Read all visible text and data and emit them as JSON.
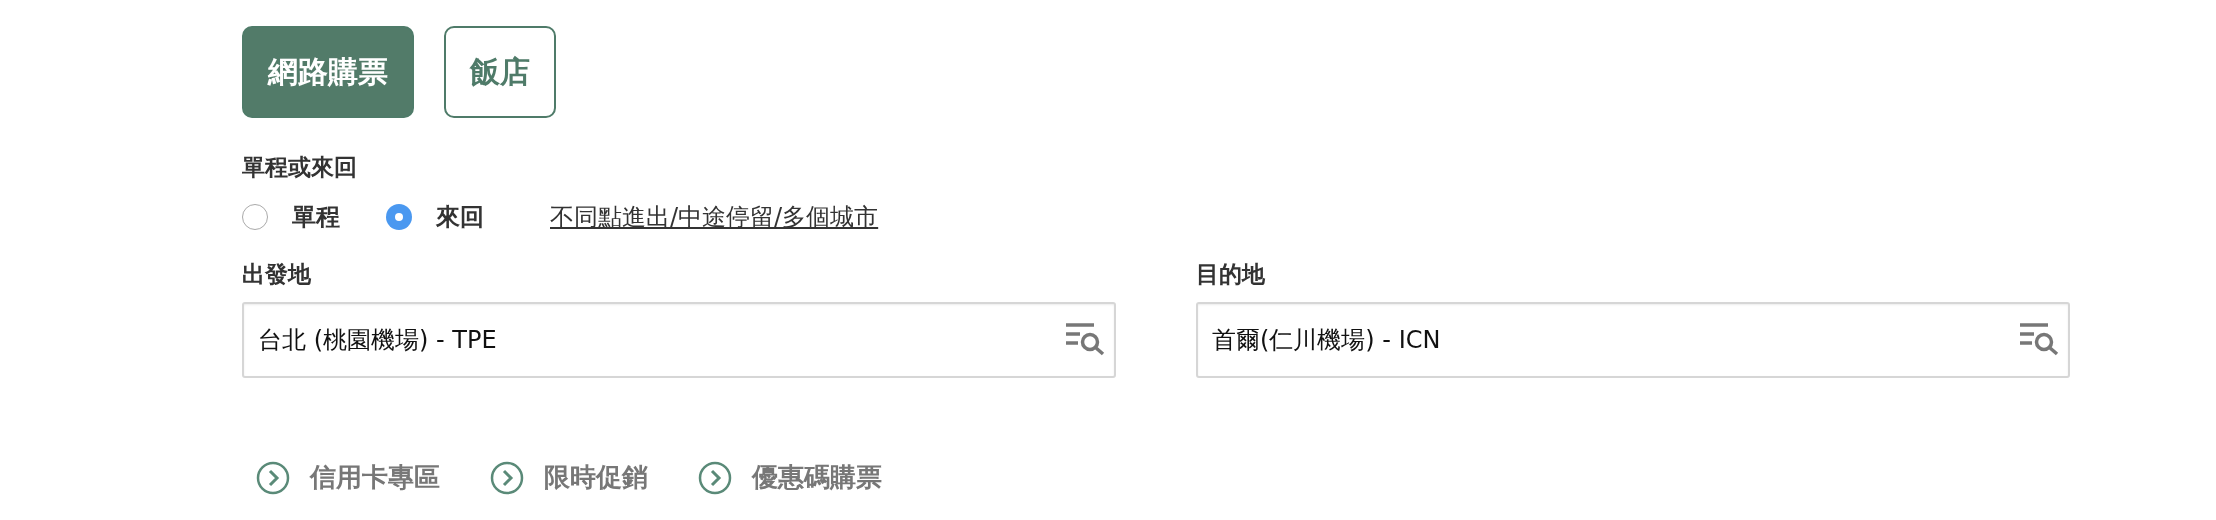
{
  "tabs": [
    {
      "label": "網路購票",
      "selected": true
    },
    {
      "label": "飯店",
      "selected": false
    }
  ],
  "trip_type": {
    "label": "單程或來回",
    "options": [
      {
        "label": "單程",
        "selected": false
      },
      {
        "label": "來回",
        "selected": true
      }
    ],
    "link": "不同點進出/中途停留/多個城市"
  },
  "fields": [
    {
      "label": "出發地",
      "value": "台北 (桃園機場) - TPE"
    },
    {
      "label": "目的地",
      "value": "首爾(仁川機場) - ICN"
    }
  ],
  "links": [
    "信用卡專區",
    "限時促銷",
    "優惠碼購票"
  ]
}
